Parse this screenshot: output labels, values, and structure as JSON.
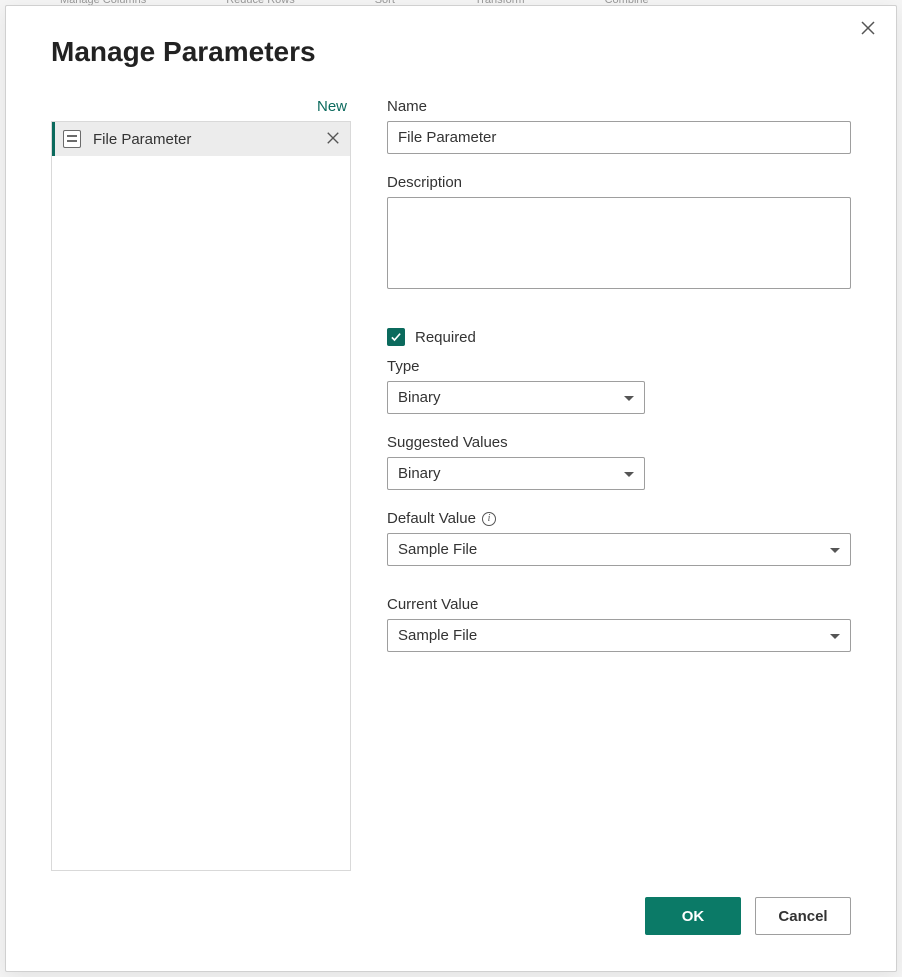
{
  "dialog": {
    "title": "Manage Parameters"
  },
  "sidebar": {
    "new_label": "New",
    "items": [
      {
        "label": "File Parameter"
      }
    ]
  },
  "form": {
    "name_label": "Name",
    "name_value": "File Parameter",
    "description_label": "Description",
    "description_value": "",
    "required_label": "Required",
    "required_checked": true,
    "type_label": "Type",
    "type_value": "Binary",
    "suggested_label": "Suggested Values",
    "suggested_value": "Binary",
    "default_label": "Default Value",
    "default_value": "Sample File",
    "current_label": "Current Value",
    "current_value": "Sample File"
  },
  "footer": {
    "ok_label": "OK",
    "cancel_label": "Cancel"
  },
  "bg": {
    "a": "Manage Columns",
    "b": "Reduce Rows",
    "c": "Sort",
    "d": "Transform",
    "e": "Combine"
  }
}
